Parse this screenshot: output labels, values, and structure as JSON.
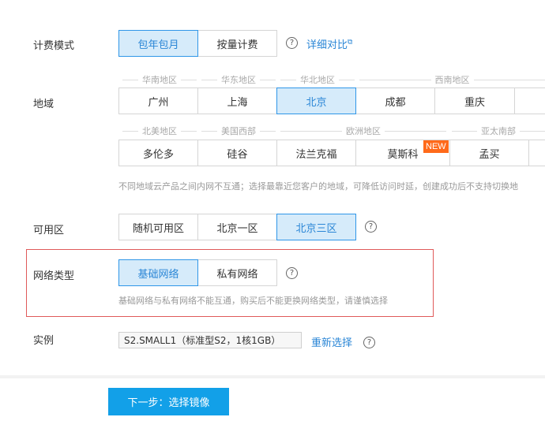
{
  "billing": {
    "label": "计费模式",
    "options": [
      "包年包月",
      "按量计费"
    ],
    "compare_link": "详细对比"
  },
  "region": {
    "label": "地域",
    "row1_groups": [
      "华南地区",
      "华东地区",
      "华北地区",
      "西南地区"
    ],
    "row1_options": [
      "广州",
      "上海",
      "北京",
      "成都",
      "重庆"
    ],
    "row2_groups": [
      "北美地区",
      "美国西部",
      "欧洲地区",
      "亚太南部"
    ],
    "row2_options": [
      "多伦多",
      "硅谷",
      "法兰克福",
      "莫斯科",
      "孟买"
    ],
    "new_badge": "NEW",
    "hint": "不同地域云产品之间内网不互通；选择最靠近您客户的地域，可降低访问时延，创建成功后不支持切换地"
  },
  "zone": {
    "label": "可用区",
    "options": [
      "随机可用区",
      "北京一区",
      "北京三区"
    ]
  },
  "network": {
    "label": "网络类型",
    "options": [
      "基础网络",
      "私有网络"
    ],
    "hint": "基础网络与私有网络不能互通，购买后不能更换网络类型，请谨慎选择"
  },
  "instance": {
    "label": "实例",
    "value": "S2.SMALL1（标准型S2，1核1GB）",
    "reselect_link": "重新选择"
  },
  "footer": {
    "next_button": "下一步：选择镜像"
  },
  "icons": {
    "help": "?",
    "external": "⧉"
  },
  "colors": {
    "selected_bg": "#d6ebfa",
    "selected_border": "#2f96e8",
    "link": "#2a86d6",
    "primary_button": "#12a0e8",
    "highlight_border": "#e05a5a",
    "new_badge": "#ff6a1a"
  }
}
